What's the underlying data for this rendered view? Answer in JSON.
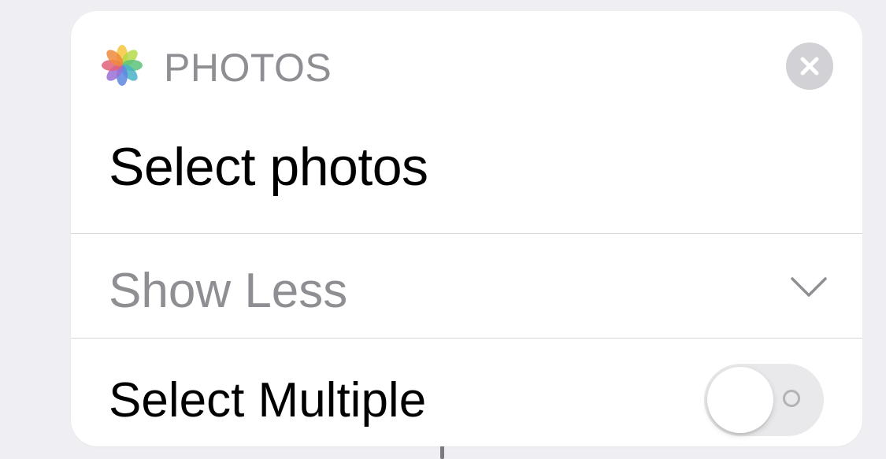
{
  "action": {
    "app_name": "PHOTOS",
    "app_icon": "photos-app-icon",
    "title": "Select photos",
    "close_icon": "close-icon"
  },
  "options_row": {
    "label": "Show Less",
    "icon": "chevron-down-icon"
  },
  "parameters": [
    {
      "label": "Select Multiple",
      "type": "toggle",
      "value": false
    }
  ],
  "colors": {
    "app_name": "#8e8e93",
    "close_button_bg": "#d1d1d6",
    "toggle_track_off": "#e9e9eb",
    "card_bg": "#ffffff",
    "page_bg": "#efeff3"
  }
}
